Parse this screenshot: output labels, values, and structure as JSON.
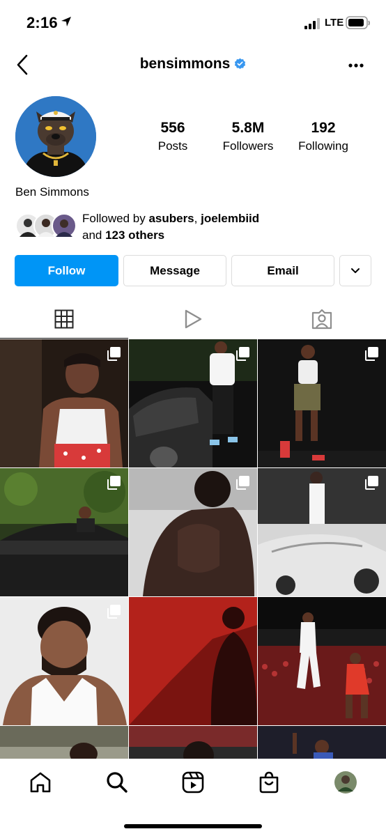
{
  "status_bar": {
    "time": "2:16",
    "network": "LTE",
    "icons": [
      "location-arrow-icon",
      "signal-bars-icon",
      "battery-icon"
    ]
  },
  "header": {
    "username": "bensimmons",
    "verified": true,
    "icons": [
      "chevron-left-icon",
      "verified-badge-icon",
      "more-horizontal-icon"
    ]
  },
  "profile": {
    "display_name": "Ben Simmons",
    "stats": {
      "posts_value": "556",
      "posts_label": "Posts",
      "followers_value": "5.8M",
      "followers_label": "Followers",
      "following_value": "192",
      "following_label": "Following"
    },
    "followed_by": {
      "prefix": "Followed by ",
      "user1": "asubers",
      "separator": ", ",
      "user2": "joelembiid",
      "and_text": "and ",
      "others": "123 others"
    }
  },
  "actions": {
    "follow": "Follow",
    "message": "Message",
    "email": "Email"
  },
  "tabs": [
    "grid-icon",
    "reels-play-icon",
    "tagged-person-icon"
  ],
  "grid": {
    "columns": 3,
    "posts": [
      {
        "multi": true,
        "desc": "portrait"
      },
      {
        "multi": true,
        "desc": "car"
      },
      {
        "multi": true,
        "desc": "court"
      },
      {
        "multi": true,
        "desc": "convertible"
      },
      {
        "multi": true,
        "desc": "back"
      },
      {
        "multi": true,
        "desc": "ferrari"
      },
      {
        "multi": true,
        "desc": "portrait-white"
      },
      {
        "multi": false,
        "desc": "red-silhouette"
      },
      {
        "multi": false,
        "desc": "game-action"
      },
      {
        "multi": false,
        "desc": "partial"
      },
      {
        "multi": false,
        "desc": "partial"
      },
      {
        "multi": false,
        "desc": "partial"
      }
    ]
  },
  "bottom_nav": [
    "home-icon",
    "search-icon",
    "reels-icon",
    "shop-icon",
    "profile-avatar-icon"
  ],
  "colors": {
    "accent": "#0095f6",
    "verified": "#3897f0",
    "border": "#dbdbdb"
  }
}
